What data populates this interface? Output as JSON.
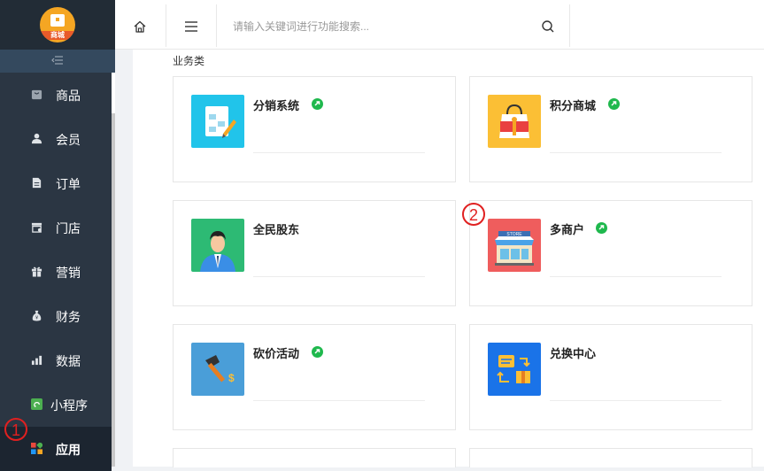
{
  "logo": {
    "label": "商城"
  },
  "sidebar": {
    "items": [
      {
        "label": "商品",
        "icon": "bag-icon"
      },
      {
        "label": "会员",
        "icon": "user-icon"
      },
      {
        "label": "订单",
        "icon": "document-icon"
      },
      {
        "label": "门店",
        "icon": "store-icon"
      },
      {
        "label": "营销",
        "icon": "gift-icon"
      },
      {
        "label": "财务",
        "icon": "money-bag-icon"
      },
      {
        "label": "数据",
        "icon": "bar-chart-icon"
      },
      {
        "label": "小程序",
        "icon": "mini-program-icon"
      },
      {
        "label": "应用",
        "icon": "apps-icon",
        "active": true
      }
    ]
  },
  "topbar": {
    "search_placeholder": "请输入关键词进行功能搜索..."
  },
  "section": {
    "title": "业务类"
  },
  "cards": [
    {
      "name": "分销系统",
      "linked": true
    },
    {
      "name": "积分商城",
      "linked": true
    },
    {
      "name": "全民股东",
      "linked": false
    },
    {
      "name": "多商户",
      "linked": true
    },
    {
      "name": "砍价活动",
      "linked": true
    },
    {
      "name": "兑换中心",
      "linked": false
    }
  ],
  "annotations": {
    "one": "1",
    "two": "2"
  },
  "colors": {
    "sidebar_bg": "#2b3643",
    "link_badge": "#1fb84d",
    "annotation": "#e02020"
  }
}
